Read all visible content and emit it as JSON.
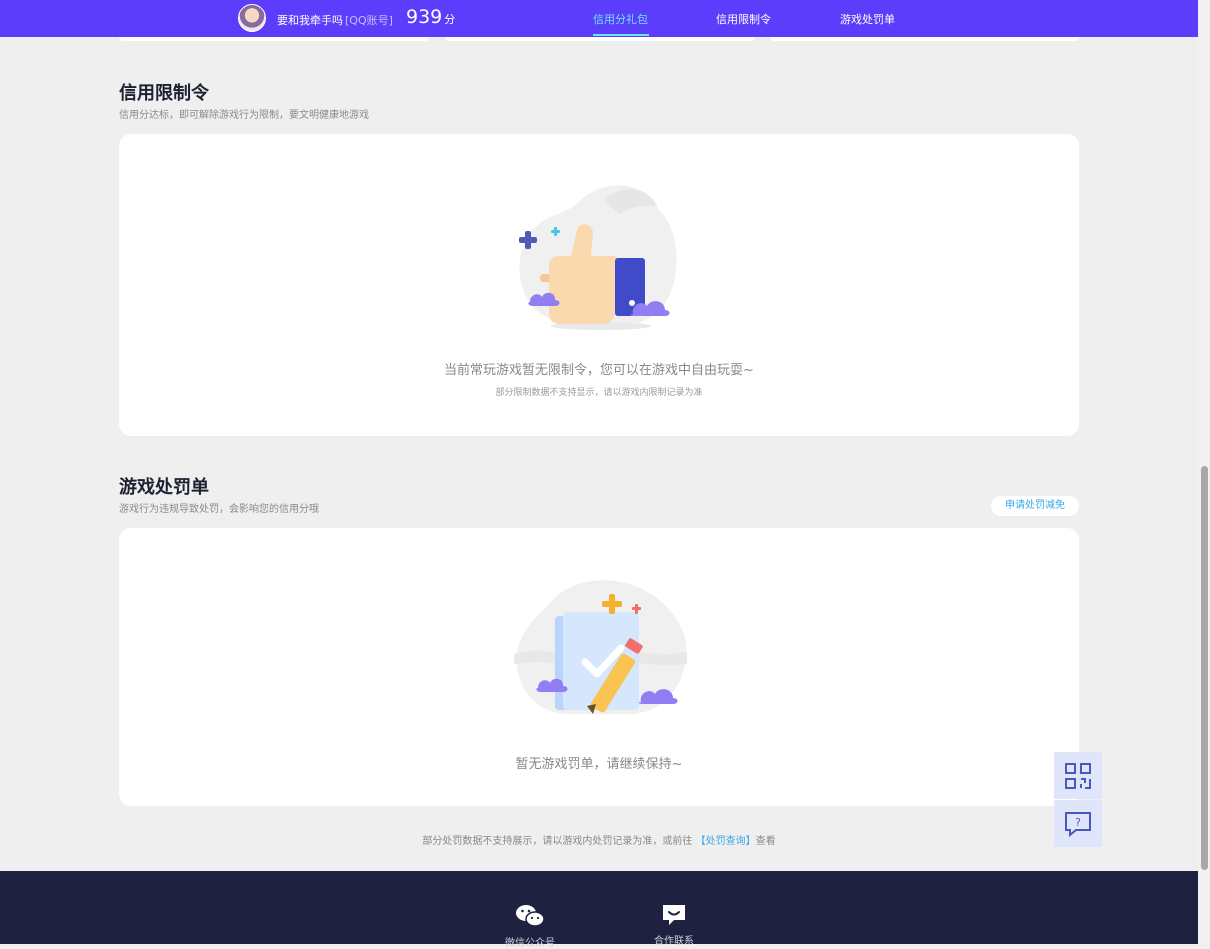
{
  "header": {
    "username": "要和我牵手吗",
    "account_type": "[QQ账号]",
    "score": "939",
    "score_unit": "分",
    "nav": [
      {
        "label": "信用分礼包",
        "active": true
      },
      {
        "label": "信用限制令",
        "active": false
      },
      {
        "label": "游戏处罚单",
        "active": false
      }
    ]
  },
  "restriction": {
    "title": "信用限制令",
    "subtitle": "信用分达标，即可解除游戏行为限制，要文明健康地游戏",
    "empty_text": "当前常玩游戏暂无限制令，您可以在游戏中自由玩耍~",
    "empty_note": "部分限制数据不支持显示，请以游戏内限制记录为准"
  },
  "penalty": {
    "title": "游戏处罚单",
    "subtitle": "游戏行为违规导致处罚，会影响您的信用分哦",
    "apply_button": "申请处罚减免",
    "empty_text": "暂无游戏罚单，请继续保持~",
    "note_prefix": "部分处罚数据不支持展示，请以游戏内处罚记录为准，或前往",
    "note_link": "【处罚查询】",
    "note_suffix": "查看"
  },
  "footer": {
    "items": [
      {
        "label": "微信公众号",
        "icon": "wechat-icon"
      },
      {
        "label": "合作联系",
        "icon": "chat-bubble-icon"
      }
    ]
  },
  "colors": {
    "header_bg": "#5b3dfb",
    "accent": "#6fe3f6",
    "link": "#3aa8ec",
    "footer_bg": "#1e2140",
    "page_bg": "#efefef"
  },
  "tools": {
    "qr": "qr-code-icon",
    "feedback": "feedback-icon"
  }
}
